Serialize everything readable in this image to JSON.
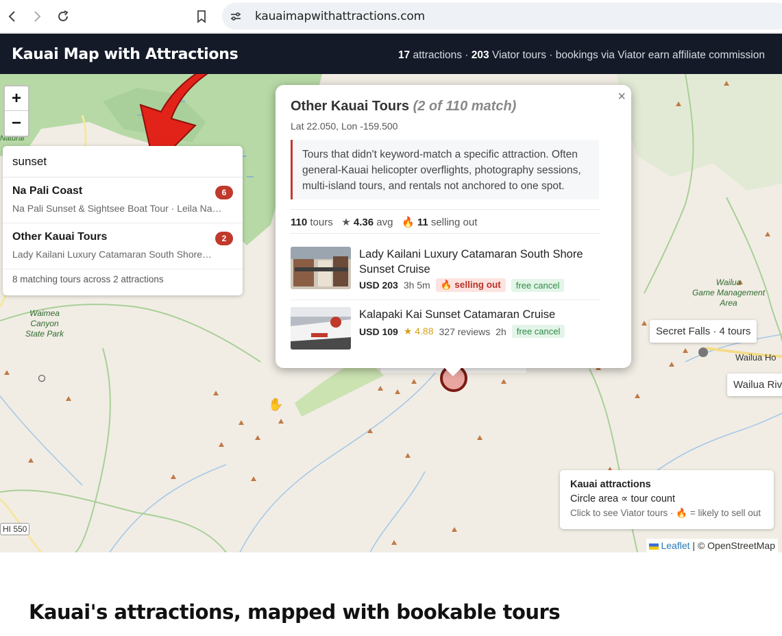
{
  "browser": {
    "url": "kauaimapwithattractions.com"
  },
  "header": {
    "title": "Kauai Map with Attractions",
    "stats": {
      "attractions_count": "17",
      "attractions_label": "attractions · ",
      "tours_count": "203",
      "tours_label": "Viator tours · bookings via Viator earn affiliate commission"
    }
  },
  "map": {
    "zoom_in": "+",
    "zoom_out": "−",
    "road_label": "HI 550",
    "place_labels": {
      "natural": "Natural",
      "waimea_canyon": "Waimea\nCanyon\nState Park",
      "wailua_game": "Wailua\nGame Management\nArea",
      "wailua_ho": "Wailua Ho"
    }
  },
  "search": {
    "query": "sunset",
    "results": [
      {
        "name": "Na Pali Coast",
        "count": "6",
        "sub": "Na Pali Sunset & Sightsee Boat Tour · Leila Na…"
      },
      {
        "name": "Other Kauai Tours",
        "count": "2",
        "sub": "Lady Kailani Luxury Catamaran South Shore…"
      }
    ],
    "footer": "8 matching tours across 2 attractions"
  },
  "popup": {
    "title": "Other Kauai Tours",
    "match": "(2 of 110 match)",
    "coords": "Lat 22.050, Lon -159.500",
    "description": "Tours that didn't keyword-match a specific attraction. Often general-Kauai helicopter overflights, photography sessions, multi-island tours, and rentals not anchored to one spot.",
    "close": "×",
    "stats": {
      "tours": "110",
      "tours_label": "tours",
      "rating": "4.36",
      "rating_label": "avg",
      "selling_out": "11",
      "selling_out_label": "selling out"
    },
    "tours": [
      {
        "name": "Lady Kailani Luxury Catamaran South Shore Sunset Cruise",
        "price": "USD 203",
        "duration": "3h 5m",
        "selling_out": "selling out",
        "cancel": "free cancel"
      },
      {
        "name": "Kalapaki Kai Sunset Catamaran Cruise",
        "price": "USD 109",
        "rating": "★ 4.88",
        "reviews": "327 reviews",
        "duration": "2h",
        "cancel": "free cancel"
      }
    ]
  },
  "labels": {
    "secret_falls": "Secret Falls · 4 tours",
    "wailua_river": "Wailua Riv"
  },
  "legend": {
    "title": "Kauai attractions",
    "line1": "Circle area ∝ tour count",
    "line2_a": "Click to see Viator tours · ",
    "line2_b": " = likely to sell out"
  },
  "attribution": {
    "leaflet": "Leaflet",
    "osm": "| © OpenStreetMap"
  },
  "page": {
    "section_title": "Kauai's attractions, mapped with bookable tours"
  },
  "colors": {
    "header_bg": "#141a28",
    "accent_red": "#c0392b",
    "forest_green": "#b7d9a6",
    "map_bg": "#f1ede5"
  }
}
